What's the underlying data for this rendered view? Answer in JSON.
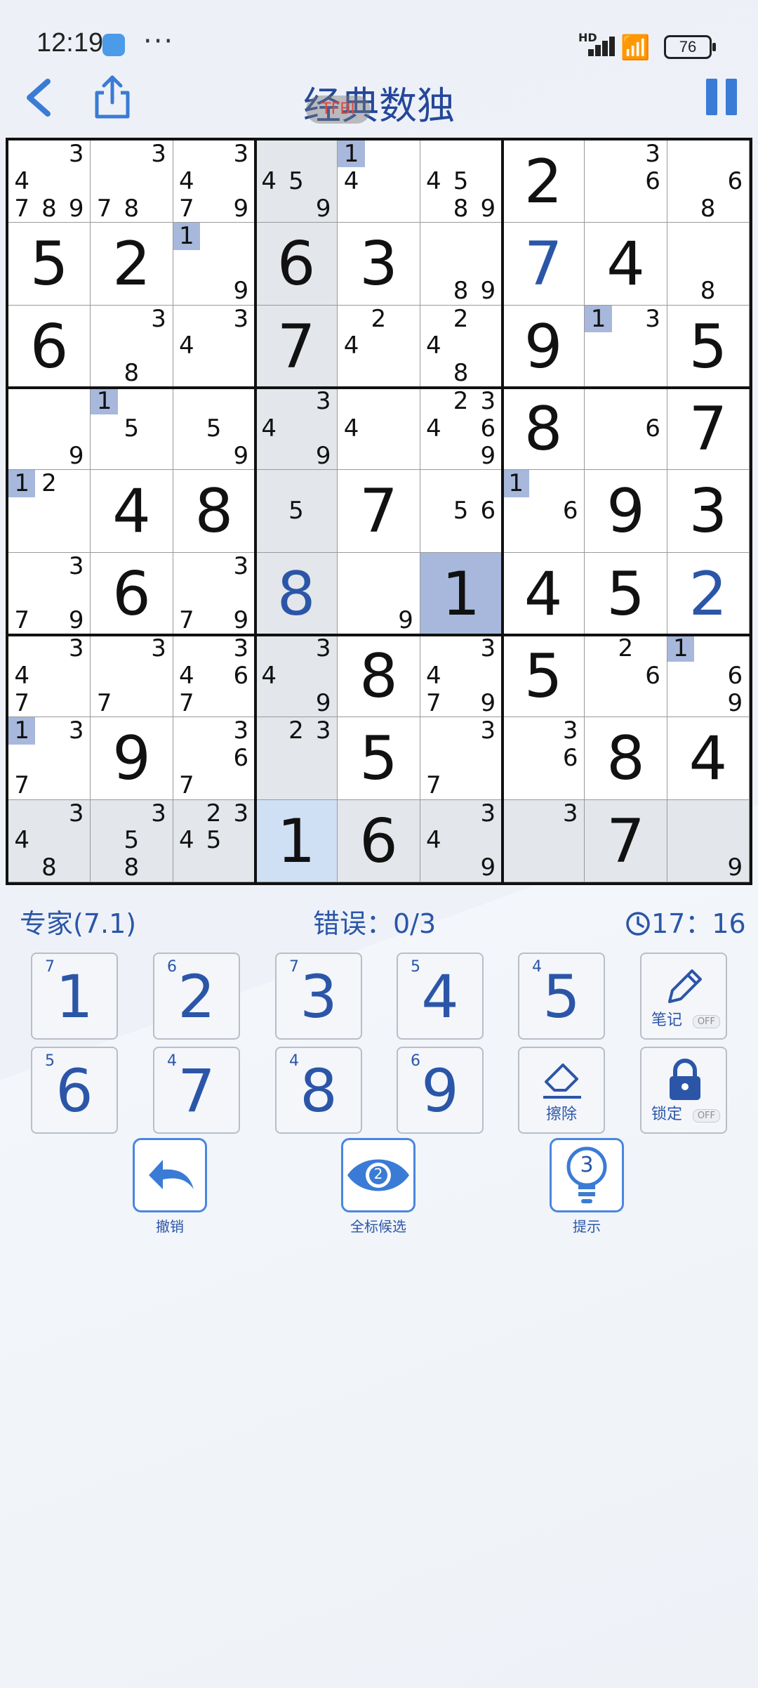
{
  "status_bar": {
    "time": "12:19",
    "more": "···",
    "network": "HD",
    "battery": "76"
  },
  "header": {
    "title": "经典数独",
    "badge": "TFBI"
  },
  "game": {
    "level": "专家(7.1)",
    "errors": "错误：0/3",
    "timer": "17：16"
  },
  "grid": [
    [
      {
        "n": [
          3,
          4,
          7,
          8,
          9
        ]
      },
      {
        "n": [
          3,
          7,
          8
        ]
      },
      {
        "n": [
          3,
          4,
          7,
          9
        ]
      },
      {
        "n": [
          4,
          5,
          9
        ]
      },
      {
        "n": [
          1,
          4
        ],
        "h": 1
      },
      {
        "n": [
          4,
          5,
          8,
          9
        ]
      },
      {
        "v": 2
      },
      {
        "n": [
          3,
          6
        ]
      },
      {
        "n": [
          6,
          8
        ]
      }
    ],
    [
      {
        "v": 5
      },
      {
        "v": 2
      },
      {
        "n": [
          1,
          9
        ],
        "h": 1
      },
      {
        "v": 6
      },
      {
        "v": 3
      },
      {
        "n": [
          8,
          9
        ]
      },
      {
        "v": 7,
        "u": true
      },
      {
        "v": 4
      },
      {
        "n": [
          8
        ]
      }
    ],
    [
      {
        "v": 6
      },
      {
        "n": [
          3,
          8
        ]
      },
      {
        "n": [
          3,
          4
        ]
      },
      {
        "v": 7
      },
      {
        "n": [
          2,
          4
        ]
      },
      {
        "n": [
          2,
          4,
          8
        ]
      },
      {
        "v": 9
      },
      {
        "n": [
          1,
          3
        ],
        "h": 1
      },
      {
        "v": 5
      }
    ],
    [
      {
        "n": [
          9
        ]
      },
      {
        "n": [
          1,
          5
        ],
        "h": 1
      },
      {
        "n": [
          5,
          9
        ]
      },
      {
        "n": [
          3,
          4,
          9
        ]
      },
      {
        "n": [
          4
        ]
      },
      {
        "n": [
          2,
          3,
          4,
          6,
          9
        ]
      },
      {
        "v": 8
      },
      {
        "n": [
          6
        ]
      },
      {
        "v": 7
      }
    ],
    [
      {
        "n": [
          1,
          2
        ],
        "h": 1
      },
      {
        "v": 4
      },
      {
        "v": 8
      },
      {
        "n": [
          5
        ]
      },
      {
        "v": 7
      },
      {
        "n": [
          5,
          6
        ]
      },
      {
        "n": [
          1,
          6
        ],
        "h": 1
      },
      {
        "v": 9
      },
      {
        "v": 3
      }
    ],
    [
      {
        "n": [
          3,
          7,
          9
        ]
      },
      {
        "v": 6
      },
      {
        "n": [
          3,
          7,
          9
        ]
      },
      {
        "v": 8,
        "u": true
      },
      {
        "n": [
          9
        ]
      },
      {
        "v": 1
      },
      {
        "v": 4
      },
      {
        "v": 5
      },
      {
        "v": 2,
        "u": true
      }
    ],
    [
      {
        "n": [
          3,
          4,
          7
        ]
      },
      {
        "n": [
          3,
          7
        ]
      },
      {
        "n": [
          3,
          4,
          6,
          7
        ]
      },
      {
        "n": [
          3,
          4,
          9
        ]
      },
      {
        "v": 8
      },
      {
        "n": [
          3,
          4,
          7,
          9
        ]
      },
      {
        "v": 5
      },
      {
        "n": [
          2,
          6
        ]
      },
      {
        "n": [
          1,
          6,
          9
        ],
        "h": 1
      }
    ],
    [
      {
        "n": [
          1,
          3,
          7
        ],
        "h": 1
      },
      {
        "v": 9
      },
      {
        "n": [
          3,
          6,
          7
        ]
      },
      {
        "n": [
          2,
          3
        ]
      },
      {
        "v": 5
      },
      {
        "n": [
          3,
          7
        ]
      },
      {
        "n": [
          3,
          6
        ]
      },
      {
        "v": 8
      },
      {
        "v": 4
      }
    ],
    [
      {
        "n": [
          3,
          4,
          8
        ]
      },
      {
        "n": [
          3,
          5,
          8
        ]
      },
      {
        "n": [
          2,
          3,
          4,
          5
        ]
      },
      {
        "v": 1
      },
      {
        "v": 6
      },
      {
        "n": [
          3,
          4,
          9
        ]
      },
      {
        "n": [
          3
        ]
      },
      {
        "v": 7
      },
      {
        "n": [
          9
        ]
      }
    ]
  ],
  "digits": [
    {
      "digit": "1",
      "count": "7"
    },
    {
      "digit": "2",
      "count": "6"
    },
    {
      "digit": "3",
      "count": "7"
    },
    {
      "digit": "4",
      "count": "5"
    },
    {
      "digit": "5",
      "count": "4"
    },
    {
      "digit": "6",
      "count": "5"
    },
    {
      "digit": "7",
      "count": "4"
    },
    {
      "digit": "8",
      "count": "4"
    },
    {
      "digit": "9",
      "count": "6"
    }
  ],
  "tools": {
    "notes": "笔记",
    "erase": "擦除",
    "lock": "锁定",
    "off": "OFF"
  },
  "actions": {
    "undo": "撤销",
    "all_candidates": "全标候选",
    "all_candidates_count": "2",
    "hint": "提示",
    "hint_count": "3"
  },
  "colors": {
    "accent": "#2b56a8",
    "highlight": "#a7b8dc",
    "selected": "#cfe0f5",
    "row_col": "#e3e6ea"
  }
}
